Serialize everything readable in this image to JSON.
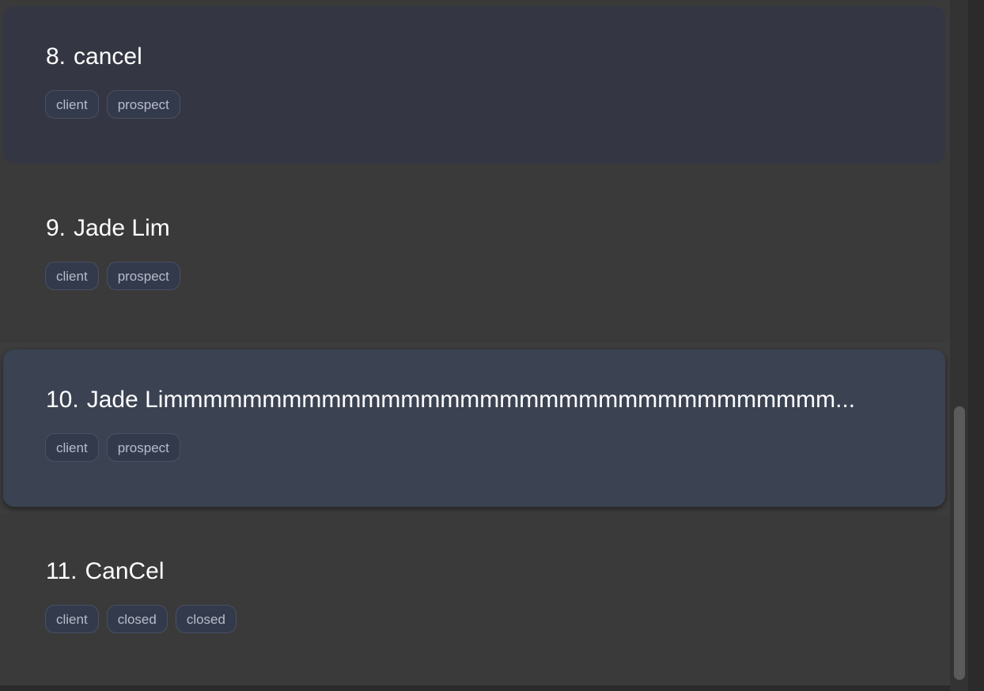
{
  "persons": [
    {
      "index": "8.",
      "name": "cancel",
      "tags": [
        "client",
        "prospect"
      ]
    },
    {
      "index": "9.",
      "name": "Jade Lim",
      "tags": [
        "client",
        "prospect"
      ]
    },
    {
      "index": "10.",
      "name": "Jade Limmmmmmmmmmmmmmmmmmmmmmmmmmmmmmmmmm...",
      "tags": [
        "client",
        "prospect"
      ]
    },
    {
      "index": "11.",
      "name": "CanCel",
      "tags": [
        "client",
        "closed",
        "closed"
      ]
    }
  ]
}
